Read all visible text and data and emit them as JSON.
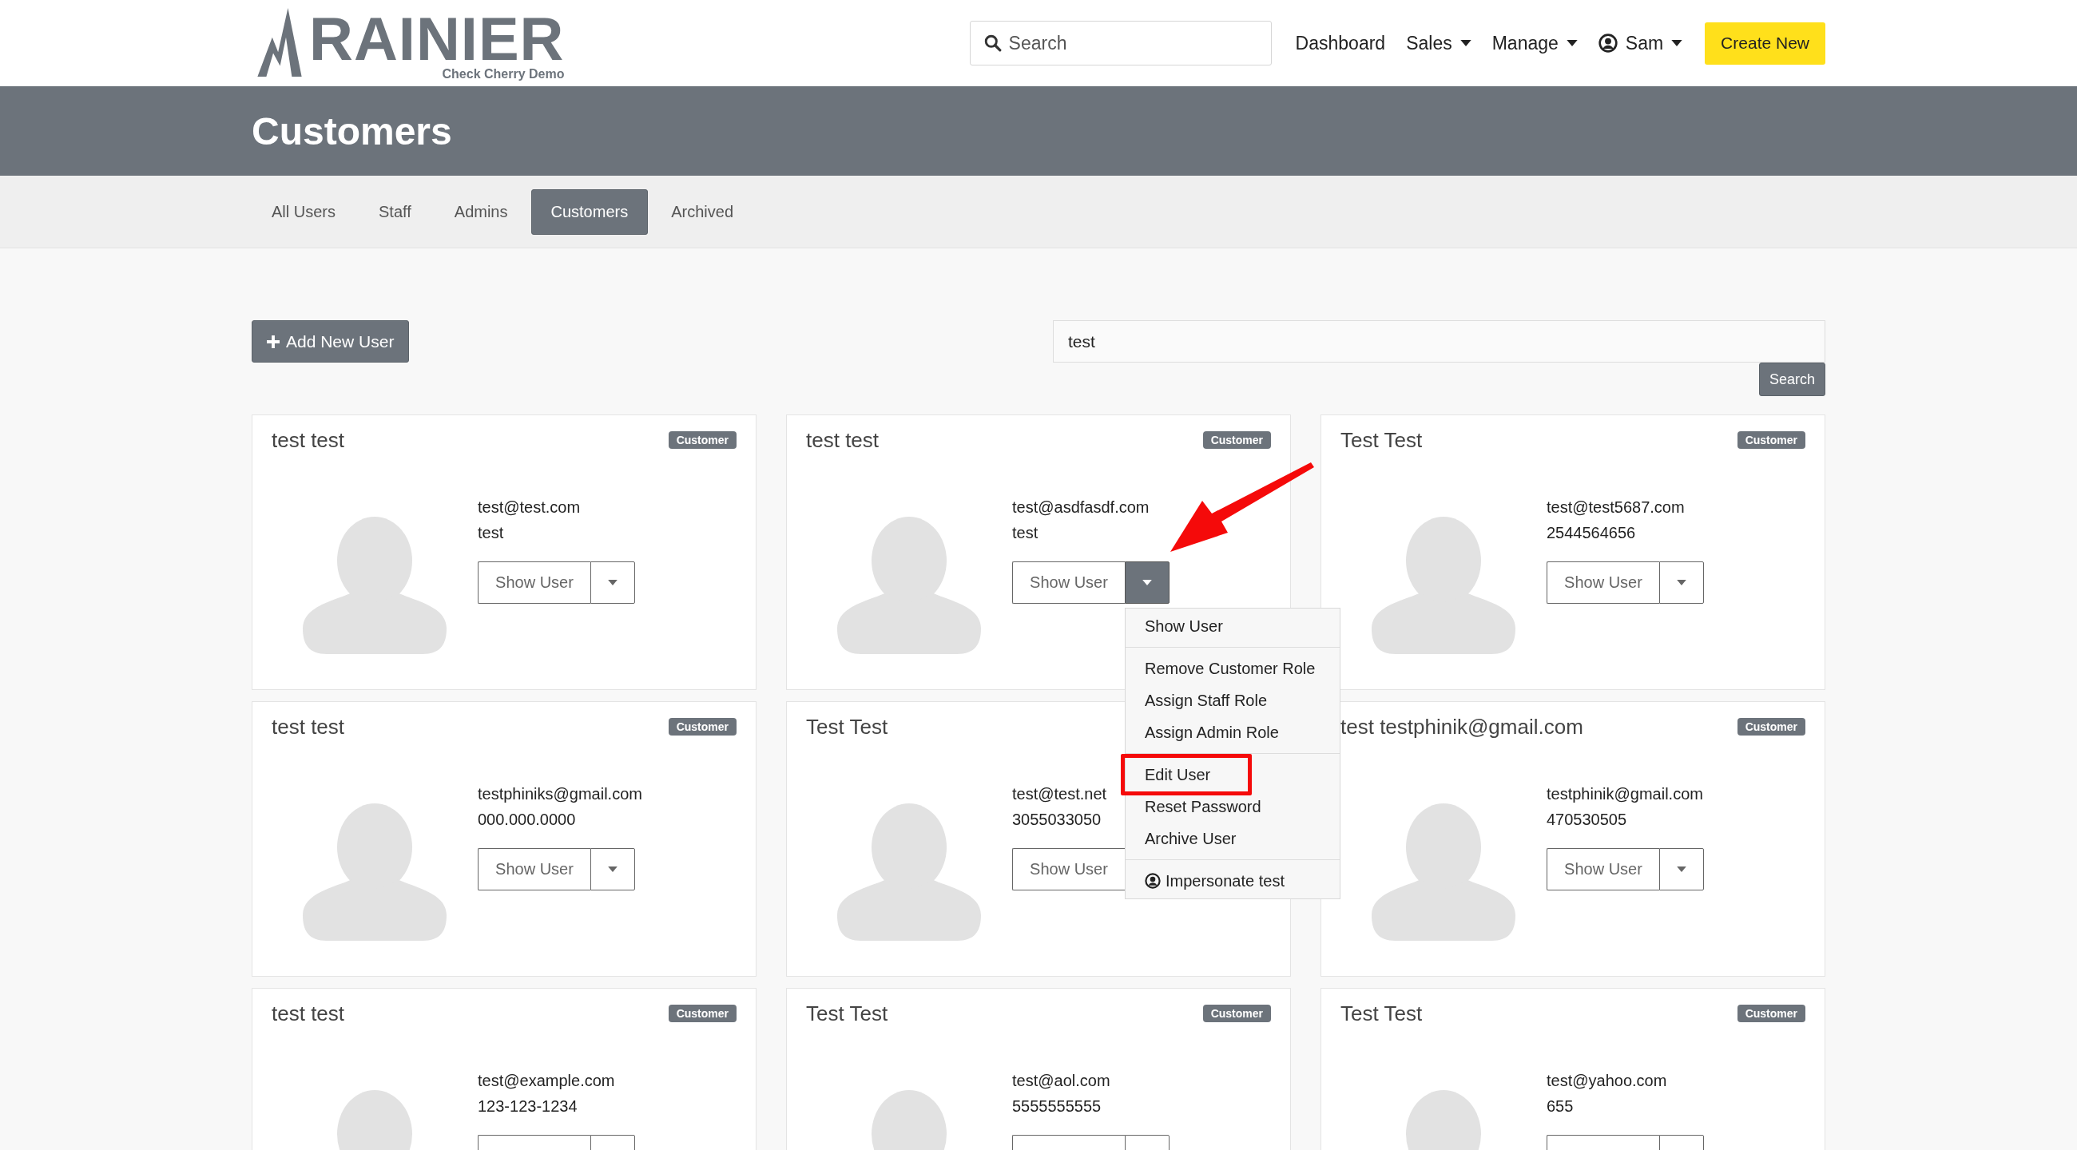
{
  "logo": {
    "name": "RAINIER",
    "tagline": "Check Cherry Demo"
  },
  "nav": {
    "search": {
      "placeholder": "Search"
    },
    "links": [
      {
        "kind": "link",
        "label": "Dashboard",
        "dropdown": false
      },
      {
        "kind": "link",
        "label": "Sales",
        "dropdown": true
      },
      {
        "kind": "link",
        "label": "Manage",
        "dropdown": true
      },
      {
        "kind": "user",
        "label": "Sam",
        "dropdown": true
      }
    ],
    "create_button": "Create New"
  },
  "page_title": "Customers",
  "tabs": [
    {
      "label": "All Users",
      "selected": false
    },
    {
      "label": "Staff",
      "selected": false
    },
    {
      "label": "Admins",
      "selected": false
    },
    {
      "label": "Customers",
      "selected": true
    },
    {
      "label": "Archived",
      "selected": false
    }
  ],
  "add_button": "Add New User",
  "filter": {
    "value": "test",
    "button": "Search"
  },
  "cards": [
    {
      "name": "test test",
      "badge": "Customer",
      "email": "test@test.com",
      "phone": "test",
      "button": "Show User",
      "menu_open": false
    },
    {
      "name": "test test",
      "badge": "Customer",
      "email": "test@asdfasdf.com",
      "phone": "test",
      "button": "Show User",
      "menu_open": true
    },
    {
      "name": "Test Test",
      "badge": "Customer",
      "email": "test@test5687.com",
      "phone": "2544564656",
      "button": "Show User",
      "menu_open": false
    },
    {
      "name": "test test",
      "badge": "Customer",
      "email": "testphiniks@gmail.com",
      "phone": "000.000.0000",
      "button": "Show User",
      "menu_open": false
    },
    {
      "name": "Test Test",
      "email": "test@test.net",
      "phone": "3055033050",
      "button": "Show User",
      "menu_open": false
    },
    {
      "name": "test testphinik@gmail.com",
      "badge": "Customer",
      "email": "testphinik@gmail.com",
      "phone": "470530505",
      "button": "Show User",
      "menu_open": false
    },
    {
      "name": "test test",
      "badge": "Customer",
      "email": "test@example.com",
      "phone": "123-123-1234",
      "menu_open": false
    },
    {
      "name": "Test Test",
      "badge": "Customer",
      "email": "test@aol.com",
      "phone": "5555555555",
      "menu_open": false
    },
    {
      "name": "Test Test",
      "badge": "Customer",
      "email": "test@yahoo.com",
      "phone": "655",
      "menu_open": false
    }
  ],
  "menu": {
    "items": [
      {
        "kind": "item",
        "label": "Show User",
        "highlighted": false
      },
      {
        "kind": "divider"
      },
      {
        "kind": "item",
        "label": "Remove Customer Role",
        "highlighted": false
      },
      {
        "kind": "item",
        "label": "Assign Staff Role",
        "highlighted": false
      },
      {
        "kind": "item",
        "label": "Assign Admin Role",
        "highlighted": false
      },
      {
        "kind": "divider"
      },
      {
        "kind": "item",
        "label": "Edit User",
        "highlighted": true
      },
      {
        "kind": "item",
        "label": "Reset Password",
        "highlighted": false
      },
      {
        "kind": "item",
        "label": "Archive User",
        "highlighted": false
      },
      {
        "kind": "divider"
      },
      {
        "kind": "user",
        "label": "Impersonate test",
        "highlighted": false
      }
    ]
  },
  "annotation": {
    "arrow": true
  }
}
